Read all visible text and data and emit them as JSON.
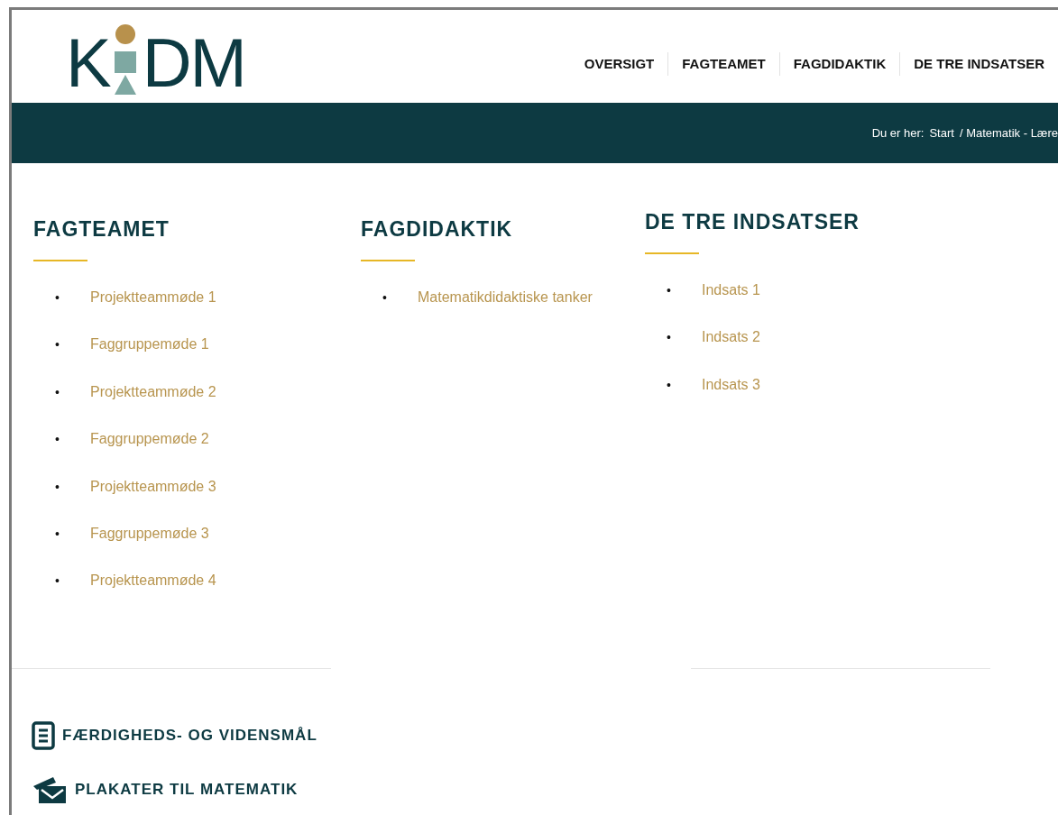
{
  "logo": {
    "left": "K",
    "right": "DM"
  },
  "nav": [
    {
      "label": "OVERSIGT"
    },
    {
      "label": "FAGTEAMET"
    },
    {
      "label": "FAGDIDAKTIK"
    },
    {
      "label": "DE TRE INDSATSER"
    }
  ],
  "breadcrumb": {
    "prefix": "Du er her:",
    "start": "Start",
    "trail": "/ Matematik - Lære"
  },
  "bullet": "•",
  "columns": [
    {
      "title": "FAGTEAMET",
      "items": [
        "Projektteammøde 1",
        "Faggruppemøde 1",
        "Projektteammøde 2",
        "Faggruppemøde 2",
        "Projektteammøde 3",
        "Faggruppemøde 3",
        "Projektteammøde 4"
      ]
    },
    {
      "title": "FAGDIDAKTIK",
      "items": [
        "Matematikdidaktiske tanker"
      ]
    },
    {
      "title": "DE TRE INDSATSER",
      "items": [
        "Indsats 1",
        "Indsats 2",
        "Indsats 3"
      ]
    }
  ],
  "resources": [
    {
      "kind": "document",
      "label": "FÆRDIGHEDS- OG VIDENSMÅL"
    },
    {
      "kind": "posters",
      "label": "PLAKATER TIL MATEMATIK"
    }
  ]
}
